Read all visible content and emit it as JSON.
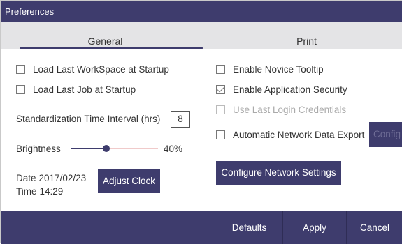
{
  "window": {
    "title": "Preferences"
  },
  "tabs": [
    {
      "label": "General",
      "active": true
    },
    {
      "label": "Print",
      "active": false
    }
  ],
  "general": {
    "left_checkboxes": [
      {
        "label": "Load Last WorkSpace at Startup",
        "checked": false
      },
      {
        "label": "Load Last Job at Startup",
        "checked": false
      }
    ],
    "right_checkboxes": [
      {
        "label": "Enable Novice Tooltip",
        "checked": false,
        "enabled": true
      },
      {
        "label": "Enable Application Security",
        "checked": true,
        "enabled": true
      },
      {
        "label": "Use Last Login Credentials",
        "checked": false,
        "enabled": false
      },
      {
        "label": "Automatic Network Data Export",
        "checked": false,
        "enabled": true
      }
    ],
    "standardization": {
      "label": "Standardization Time Interval (hrs)",
      "value": "8"
    },
    "brightness": {
      "label": "Brightness",
      "value_text": "40%",
      "level": 0.4
    },
    "date": {
      "key": "Date",
      "value": "2017/02/23"
    },
    "time": {
      "key": "Time",
      "value": "14:29"
    },
    "adjust_clock_label": "Adjust Clock",
    "config_button_label": "Config",
    "configure_network_label": "Configure Network Settings"
  },
  "footer": {
    "defaults_label": "Defaults",
    "apply_label": "Apply",
    "cancel_label": "Cancel"
  },
  "colors": {
    "accent": "#3e3c6d",
    "tab_bar": "#e4e4e6",
    "slider_remaining": "#f0caca"
  }
}
